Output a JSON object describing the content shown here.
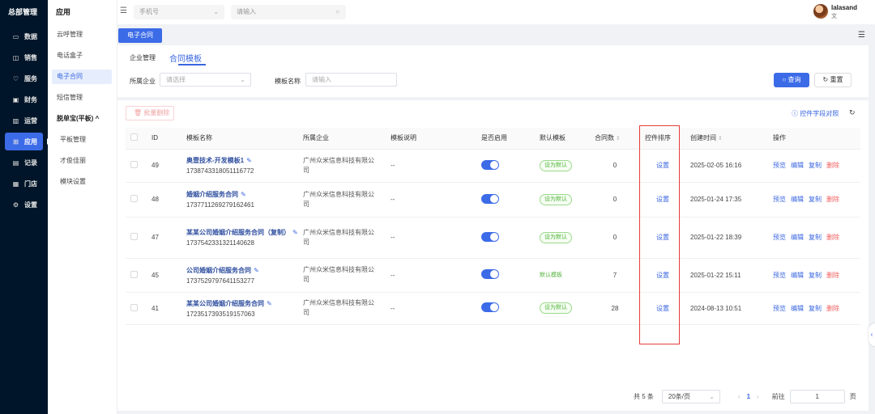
{
  "sidebar": {
    "brand": "总部管理",
    "items": [
      {
        "label": "数据",
        "icon": "▭"
      },
      {
        "label": "销售",
        "icon": "◫"
      },
      {
        "label": "服务",
        "icon": "♡"
      },
      {
        "label": "财务",
        "icon": "▣"
      },
      {
        "label": "运营",
        "icon": "▥"
      },
      {
        "label": "应用",
        "icon": "⊞"
      },
      {
        "label": "记录",
        "icon": "▤"
      },
      {
        "label": "门店",
        "icon": "▦"
      },
      {
        "label": "设置",
        "icon": "⚙"
      }
    ]
  },
  "submenu": {
    "title": "应用",
    "items": [
      "云呼管理",
      "电话盒子",
      "电子合同",
      "短信管理"
    ],
    "group": "脱单宝(平板)",
    "group_chevron": "^",
    "children": [
      "平板管理",
      "才俊佳丽",
      "模块设置"
    ]
  },
  "topbar": {
    "phone_select": "手机号",
    "search_placeholder": "请输入",
    "username": "lalasand",
    "role": "文"
  },
  "tagbar": {
    "tag": "电子合同"
  },
  "tabs": [
    "企业管理",
    "合同模板"
  ],
  "filters": {
    "company_label": "所属企业",
    "company_placeholder": "请选择",
    "template_label": "模板名称",
    "template_placeholder": "请输入",
    "query": "查询",
    "reset": "重置"
  },
  "toolbar": {
    "batch_delete": "批量删除",
    "field_compare": "控件字段对照"
  },
  "table": {
    "headers": [
      "ID",
      "模板名称",
      "所属企业",
      "模板说明",
      "是否启用",
      "默认模板",
      "合同数",
      "控件排序",
      "创建时间",
      "操作"
    ],
    "rows": [
      {
        "id": "49",
        "name": "奥壹技术-开发模板1",
        "code": "1738743318051116772",
        "company": "广州众米信息科技有限公司",
        "desc": "--",
        "enabled": true,
        "default": "设为默认",
        "is_default": false,
        "count": "0",
        "sort": "设置",
        "created": "2025-02-05 16:16"
      },
      {
        "id": "48",
        "name": "婚姻介绍服务合同",
        "code": "1737711269279162461",
        "company": "广州众米信息科技有限公司",
        "desc": "--",
        "enabled": true,
        "default": "设为默认",
        "is_default": false,
        "count": "0",
        "sort": "设置",
        "created": "2025-01-24 17:35"
      },
      {
        "id": "47",
        "name": "某某公司婚姻介绍服务合同（复制）",
        "code": "1737542331321140628",
        "company": "广州众米信息科技有限公司",
        "desc": "--",
        "enabled": true,
        "default": "设为默认",
        "is_default": false,
        "count": "0",
        "sort": "设置",
        "created": "2025-01-22 18:39"
      },
      {
        "id": "45",
        "name": "公司婚姻介绍服务合同",
        "code": "1737529797641153277",
        "company": "广州众米信息科技有限公司",
        "desc": "--",
        "enabled": true,
        "default": "默认模板",
        "is_default": true,
        "count": "7",
        "sort": "设置",
        "created": "2025-01-22 15:11"
      },
      {
        "id": "41",
        "name": "某某公司婚姻介绍服务合同",
        "code": "1723517393519157063",
        "company": "广州众米信息科技有限公司",
        "desc": "--",
        "enabled": true,
        "default": "设为默认",
        "is_default": false,
        "count": "28",
        "sort": "设置",
        "created": "2024-08-13 10:51"
      }
    ],
    "ops": [
      "预览",
      "编辑",
      "复制",
      "删除"
    ]
  },
  "pager": {
    "total": "共 5 条",
    "size": "20条/页",
    "current": "1",
    "goto": "前往",
    "page_value": "1",
    "page_unit": "页"
  },
  "colors": {
    "primary": "#3c6be8",
    "sidebar": "#001529",
    "danger": "#f05f5f",
    "success": "#52b13b",
    "highlight": "#e63b3b"
  }
}
